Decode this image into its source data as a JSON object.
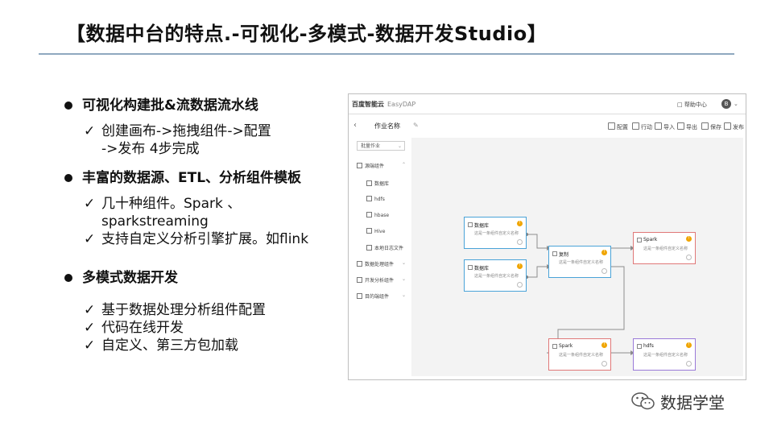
{
  "slide": {
    "title": "【数据中台的特点.-可视化-多模式-数据开发Studio】",
    "sections": [
      {
        "heading": "可视化构建批&流数据流水线",
        "items": [
          "创建画布->拖拽组件->配置\n->发布  4步完成"
        ]
      },
      {
        "heading": "丰富的数据源、ETL、分析组件模板",
        "items": [
          "几十种组件。Spark 、\nsparkstreaming",
          "支持自定义分析引擎扩展。如flink"
        ]
      },
      {
        "heading": "多模式数据开发",
        "items": [
          "基于数据处理分析组件配置",
          "代码在线开发",
          "自定义、第三方包加载"
        ]
      }
    ],
    "check_glyph": "✓",
    "watermark": "数据学堂"
  },
  "screenshot": {
    "logo": "百度智能云",
    "app_name": "EasyDAP",
    "help": "帮助中心",
    "avatar": "B",
    "job_name": "作业名称",
    "toolbar": [
      "配置",
      "行动",
      "导入",
      "导出",
      "保存",
      "发布"
    ],
    "job_type_select": "批量作业",
    "nav": [
      {
        "label": "源端组件",
        "group": true
      },
      {
        "label": "数据库",
        "group": false
      },
      {
        "label": "hdfs",
        "group": false
      },
      {
        "label": "hbase",
        "group": false
      },
      {
        "label": "Hive",
        "group": false
      },
      {
        "label": "本地日志文件",
        "group": false
      },
      {
        "label": "数据处理组件",
        "group": true
      },
      {
        "label": "开发分析组件",
        "group": true
      },
      {
        "label": "目的端组件",
        "group": true
      }
    ],
    "node_desc": "这是一条组件自定义名称",
    "nodes": [
      {
        "title": "数据库",
        "color": "#4aa3d8"
      },
      {
        "title": "数据库",
        "color": "#4aa3d8"
      },
      {
        "title": "复制",
        "color": "#4aa3d8"
      },
      {
        "title": "Spark",
        "color": "#e07878"
      },
      {
        "title": "Spark",
        "color": "#e07878"
      },
      {
        "title": "hdfs",
        "color": "#9a7ad8"
      }
    ]
  }
}
